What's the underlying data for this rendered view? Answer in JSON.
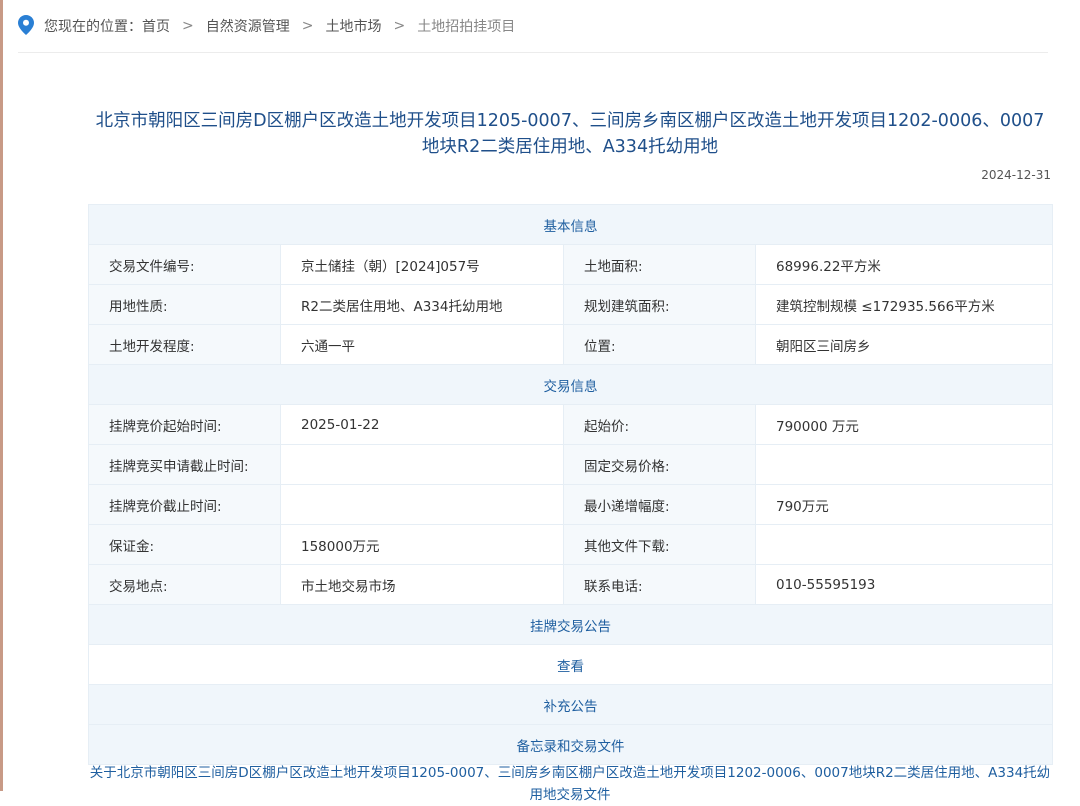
{
  "breadcrumb": {
    "prefix": "您现在的位置：",
    "items": [
      "首页",
      "自然资源管理",
      "土地市场"
    ],
    "current": "土地招拍挂项目"
  },
  "page": {
    "title": "北京市朝阳区三间房D区棚户区改造土地开发项目1205-0007、三间房乡南区棚户区改造土地开发项目1202-0006、0007地块R2二类居住用地、A334托幼用地",
    "date": "2024-12-31"
  },
  "basic": {
    "header": "基本信息",
    "rows": [
      {
        "l1": "交易文件编号:",
        "v1": "京土储挂（朝）[2024]057号",
        "l2": "土地面积:",
        "v2": "68996.22平方米"
      },
      {
        "l1": "用地性质:",
        "v1": "R2二类居住用地、A334托幼用地",
        "l2": "规划建筑面积:",
        "v2": "建筑控制规模 ≤172935.566平方米"
      },
      {
        "l1": "土地开发程度:",
        "v1": "六通一平",
        "l2": "位置:",
        "v2": "朝阳区三间房乡"
      }
    ]
  },
  "trade": {
    "header": "交易信息",
    "rows": [
      {
        "l1": "挂牌竞价起始时间:",
        "v1": "2025-01-22",
        "l2": "起始价:",
        "v2": "790000 万元"
      },
      {
        "l1": "挂牌竞买申请截止时间:",
        "v1": "",
        "l2": "固定交易价格:",
        "v2": ""
      },
      {
        "l1": "挂牌竞价截止时间:",
        "v1": "",
        "l2": "最小递增幅度:",
        "v2": "790万元"
      },
      {
        "l1": "保证金:",
        "v1": "158000万元",
        "l2": "其他文件下载:",
        "v2": ""
      },
      {
        "l1": "交易地点:",
        "v1": "市土地交易市场",
        "l2": "联系电话:",
        "v2": "010-55595193"
      }
    ]
  },
  "notice": {
    "header": "挂牌交易公告",
    "view_label": "查看",
    "supplement_header": "补充公告",
    "memo_header": "备忘录和交易文件",
    "doc_link": "关于北京市朝阳区三间房D区棚户区改造土地开发项目1205-0007、三间房乡南区棚户区改造土地开发项目1202-0006、0007地块R2二类居住用地、A334托幼用地交易文件"
  },
  "colors": {
    "link_blue": "#1f5fa0",
    "title_blue": "#1f4f8a",
    "section_bg": "#f0f6fb",
    "pin_blue": "#2a7fd4"
  }
}
